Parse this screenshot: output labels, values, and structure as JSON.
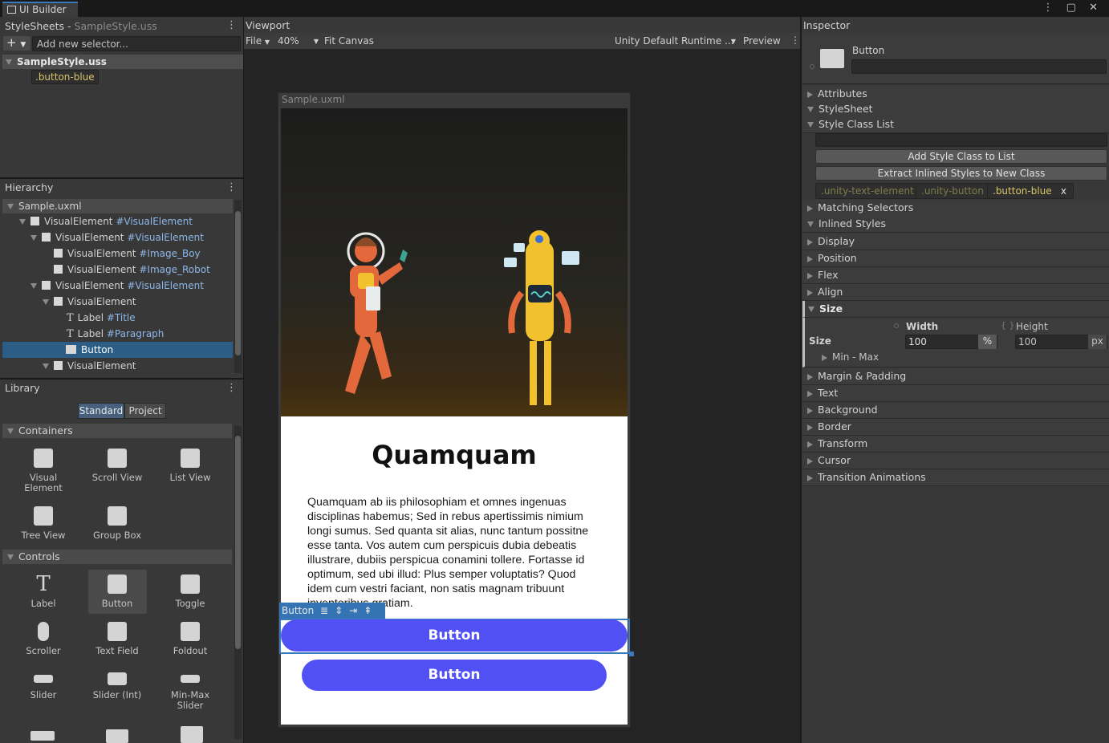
{
  "window": {
    "tab_title": "UI Builder"
  },
  "stylesheets": {
    "title": "StyleSheets",
    "subtitle": "SampleStyle.uss",
    "add_selector_placeholder": "Add new selector...",
    "sheet_name": "SampleStyle.uss",
    "selectors": [
      ".button-blue"
    ]
  },
  "hierarchy": {
    "title": "Hierarchy",
    "root": "Sample.uxml",
    "items": [
      {
        "type": "VisualElement",
        "name": "#VisualElement"
      },
      {
        "type": "VisualElement",
        "name": "#VisualElement"
      },
      {
        "type": "VisualElement",
        "name": "#Image_Boy"
      },
      {
        "type": "VisualElement",
        "name": "#Image_Robot"
      },
      {
        "type": "VisualElement",
        "name": "#VisualElement"
      },
      {
        "type": "VisualElement",
        "name": ""
      },
      {
        "type": "Label",
        "name": "#Title"
      },
      {
        "type": "Label",
        "name": "#Paragraph"
      },
      {
        "type": "Button",
        "name": ""
      },
      {
        "type": "VisualElement",
        "name": ""
      }
    ]
  },
  "library": {
    "title": "Library",
    "tabs": [
      "Standard",
      "Project"
    ],
    "containers_label": "Containers",
    "containers": [
      "Visual Element",
      "Scroll View",
      "List View",
      "Tree View",
      "Group Box"
    ],
    "controls_label": "Controls",
    "controls": [
      "Label",
      "Button",
      "Toggle",
      "Scroller",
      "Text Field",
      "Foldout",
      "Slider",
      "Slider (Int)",
      "Min-Max Slider"
    ]
  },
  "viewport": {
    "title": "Viewport",
    "file_menu": "File",
    "zoom": "40%",
    "fit_canvas": "Fit Canvas",
    "theme": "Unity Default Runtime ...",
    "preview": "Preview",
    "canvas_title": "Sample.uxml",
    "heading": "Quamquam",
    "paragraph": "Quamquam ab iis philosophiam et omnes ingenuas disciplinas habemus; Sed in rebus apertissimis nimium longi sumus. Sed quanta sit alias, nunc tantum possitne esse tanta. Vos autem cum perspicuis dubia debeatis illustrare, dubiis perspicua conamini tollere. Fortasse id optimum, sed ubi illud: Plus semper voluptatis? Quod idem cum vestri faciant, non satis magnam tribuunt inventoribus gratiam.",
    "selected_tag": "Button",
    "button1": "Button",
    "button2": "Button"
  },
  "inspector": {
    "title": "Inspector",
    "element_type": "Button",
    "sections": {
      "attributes": "Attributes",
      "stylesheet": "StyleSheet",
      "style_class_list": "Style Class List",
      "add_style_class": "Add Style Class to List",
      "extract_inline": "Extract Inlined Styles to New Class",
      "matching_selectors": "Matching Selectors",
      "inlined_styles": "Inlined Styles"
    },
    "classes": [
      ".unity-text-element",
      ".unity-button",
      ".button-blue"
    ],
    "class_remove": "x",
    "style_groups_top": [
      "Display",
      "Position",
      "Flex",
      "Align"
    ],
    "size": {
      "label": "Size",
      "row_label": "Size",
      "width_label": "Width",
      "height_label": "Height",
      "width_value": "100",
      "width_unit": "%",
      "height_value": "100",
      "height_unit": "px",
      "min_max": "Min - Max"
    },
    "style_groups_bottom": [
      "Margin & Padding",
      "Text",
      "Background",
      "Border",
      "Transform",
      "Cursor",
      "Transition Animations"
    ]
  },
  "colors": {
    "accent": "#3a79bb",
    "selection": "#2c5d87",
    "button_blue": "#5050f5"
  }
}
